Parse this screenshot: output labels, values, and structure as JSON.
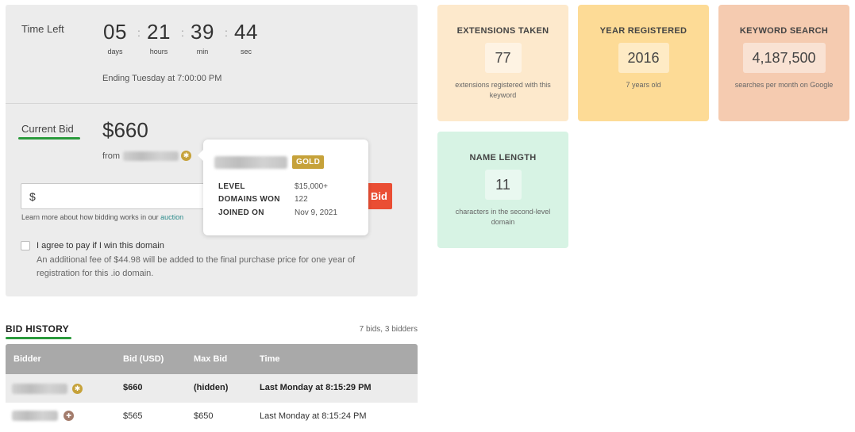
{
  "timer": {
    "label": "Time Left",
    "days": "05",
    "days_label": "days",
    "hours": "21",
    "hours_label": "hours",
    "min": "39",
    "min_label": "min",
    "sec": "44",
    "sec_label": "sec",
    "separator": ":",
    "ending": "Ending Tuesday at 7:00:00 PM"
  },
  "current_bid": {
    "label": "Current Bid",
    "amount": "$660",
    "from_label": "from"
  },
  "bid_form": {
    "input_value": "$",
    "button_label": "Bid",
    "learn_more_text": "Learn more about how bidding works in our ",
    "learn_more_link": "auction"
  },
  "agreement": {
    "label": "I agree to pay if I win this domain",
    "note": "An additional fee of $44.98 will be added to the final purchase price for one year of registration for this .io domain."
  },
  "tooltip": {
    "badge": "GOLD",
    "level_key": "LEVEL",
    "level_val": "$15,000+",
    "won_key": "DOMAINS WON",
    "won_val": "122",
    "joined_key": "JOINED ON",
    "joined_val": "Nov 9, 2021"
  },
  "bid_history": {
    "title": "BID HISTORY",
    "count": "7 bids, 3 bidders",
    "columns": [
      "Bidder",
      "Bid (USD)",
      "Max Bid",
      "Time"
    ],
    "rows": [
      {
        "bid": "$660",
        "max": "(hidden)",
        "time": "Last Monday at 8:15:29 PM"
      },
      {
        "bid": "$565",
        "max": "$650",
        "time": "Last Monday at 8:15:24 PM"
      }
    ]
  },
  "stats": [
    {
      "title": "EXTENSIONS TAKEN",
      "value": "77",
      "desc": "extensions registered with this keyword",
      "color": "#fde9cc"
    },
    {
      "title": "YEAR REGISTERED",
      "value": "2016",
      "desc": "7 years old",
      "color": "#fddb96"
    },
    {
      "title": "KEYWORD SEARCH",
      "value": "4,187,500",
      "desc": "searches per month on Google",
      "color": "#f5cbb0"
    },
    {
      "title": "NAME LENGTH",
      "value": "11",
      "desc": "characters in the second-level domain",
      "color": "#d7f3e4"
    }
  ],
  "colors": {
    "accent_green": "#2a9a3c",
    "bid_button": "#ea4e34",
    "gold_badge": "#c6a23a"
  }
}
